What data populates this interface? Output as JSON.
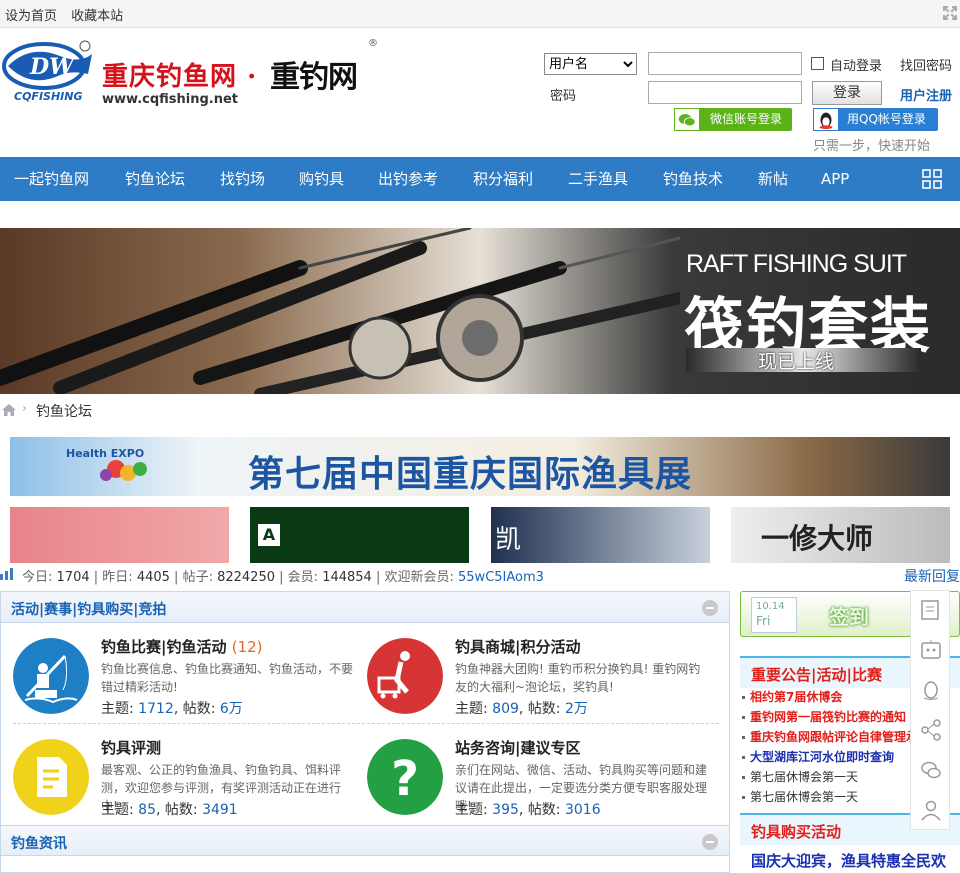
{
  "topbar": {
    "set_home": "设为首页",
    "bookmark": "收藏本站"
  },
  "logo": {
    "brand": "CQFISHING",
    "title": "重庆钓鱼网",
    "dot": "·",
    "calligraphy": "重钓网",
    "url": "www.cqfishing.net",
    "registered": "®"
  },
  "login": {
    "username_option": "用户名",
    "password_label": "密码",
    "auto_login": "自动登录",
    "forgot_password": "找回密码",
    "login_button": "登录",
    "register": "用户注册",
    "wechat_login": "微信账号登录",
    "qq_login": "用QQ帐号登录",
    "quick_start": "只需一步，快速开始"
  },
  "nav": {
    "items": [
      "一起钓鱼网",
      "钓鱼论坛",
      "找钓场",
      "购钓具",
      "出钓参考",
      "积分福利",
      "二手渔具",
      "钓鱼技术",
      "新帖",
      "APP"
    ],
    "accent": "#2e7bc6"
  },
  "banner": {
    "en": "RAFT FISHING SUIT",
    "cn": "筏钓套装",
    "online": "现已上线"
  },
  "breadcrumb": {
    "current": "钓鱼论坛"
  },
  "expo": {
    "logo_text": "Health EXPO",
    "title": "第七届中国重庆国际渔具展"
  },
  "ads": {
    "a2": "A",
    "a3": "凯",
    "a4": "一修大师"
  },
  "stats": {
    "today_label": "今日:",
    "today": "1704",
    "yesterday_label": "昨日:",
    "yesterday": "4405",
    "posts_label": "帖子:",
    "posts": "8224250",
    "members_label": "会员:",
    "members": "144854",
    "welcome_label": "欢迎新会员:",
    "new_member": "55wC5IAom3",
    "latest_reply": "最新回复"
  },
  "section1": {
    "title": "活动|赛事|钓具购买|竞拍"
  },
  "boards": [
    {
      "name": "钓鱼比赛|钓鱼活动",
      "count": "(12)",
      "desc": "钓鱼比赛信息、钓鱼比赛通知、钓鱼活动，不要错过精彩活动!",
      "topics_label": "主题:",
      "topics": "1712",
      "posts_label": "帖数:",
      "posts": "6万",
      "color": "#1f7fc4"
    },
    {
      "name": "钓具商城|积分活动",
      "count": "",
      "desc": "钓鱼神器大团购! 重钓币积分换钓具! 重钓网钓友的大福利~泡论坛，奖钓具!",
      "topics_label": "主题:",
      "topics": "809",
      "posts_label": "帖数:",
      "posts": "2万",
      "color": "#d63435"
    },
    {
      "name": "钓具评测",
      "count": "",
      "desc": "最客观、公正的钓鱼渔具、钓鱼钓具、饵料评测，欢迎您参与评测，有奖评测活动正在进行中!",
      "topics_label": "主题:",
      "topics": "85",
      "posts_label": "帖数:",
      "posts": "3491",
      "color": "#f1d21b"
    },
    {
      "name": "站务咨询|建议专区",
      "count": "",
      "desc": "亲们在网站、微信、活动、钓具购买等问题和建议请在此提出，一定要选分类方便专职客服处理哦!",
      "topics_label": "主题:",
      "topics": "395",
      "posts_label": "帖数:",
      "posts": "3016",
      "color": "#23a043"
    }
  ],
  "section2": {
    "title": "钓鱼资讯"
  },
  "sidebar": {
    "signin": {
      "date": "10.14",
      "weekday": "Fri",
      "label": "签到"
    },
    "notice_title": "重要公告|活动|比赛",
    "notices": [
      {
        "text": "相约第7届休博会",
        "style": "red"
      },
      {
        "text": "重钓网第一届筏钓比赛的通知",
        "style": "red"
      },
      {
        "text": "重庆钓鱼网跟帖评论自律管理承诺",
        "style": "red"
      },
      {
        "text": "大型湖库江河水位即时查询",
        "style": "blue"
      },
      {
        "text": "第七届休博会第一天",
        "style": "plain"
      },
      {
        "text": "第七届休博会第一天",
        "style": "plain"
      }
    ],
    "buy_title": "钓具购买活动",
    "promo": "国庆大迎宾，渔具特惠全民欢"
  }
}
